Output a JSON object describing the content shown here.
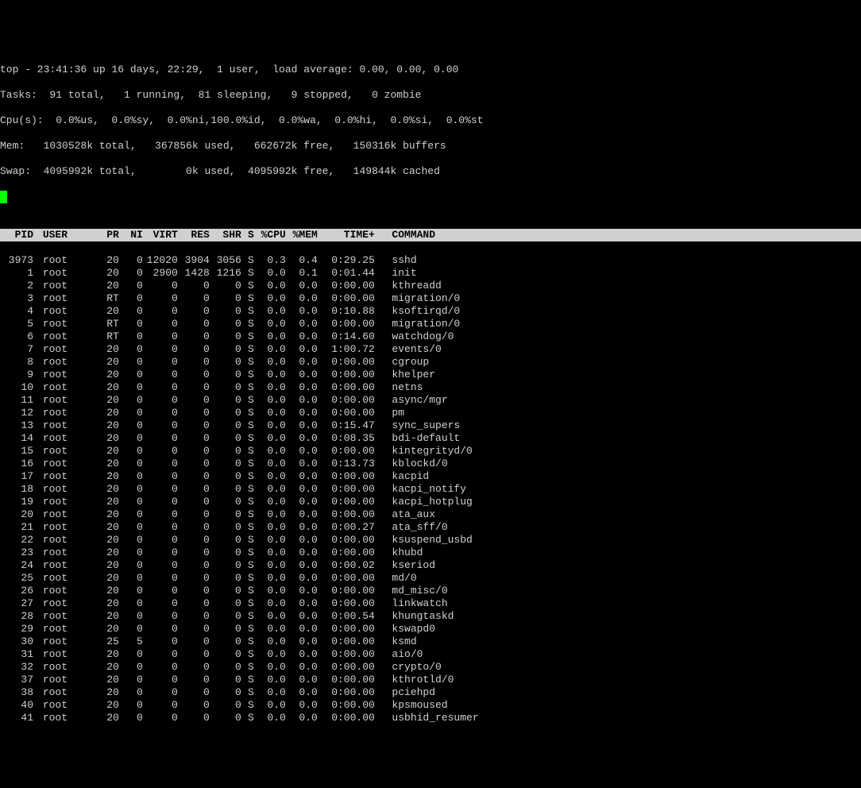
{
  "summary": {
    "line1": "top - 23:41:36 up 16 days, 22:29,  1 user,  load average: 0.00, 0.00, 0.00",
    "line2": "Tasks:  91 total,   1 running,  81 sleeping,   9 stopped,   0 zombie",
    "line3": "Cpu(s):  0.0%us,  0.0%sy,  0.0%ni,100.0%id,  0.0%wa,  0.0%hi,  0.0%si,  0.0%st",
    "line4": "Mem:   1030528k total,   367856k used,   662672k free,   150316k buffers",
    "line5": "Swap:  4095992k total,        0k used,  4095992k free,   149844k cached"
  },
  "columns": {
    "pid": "PID",
    "user": "USER",
    "pr": "PR",
    "ni": "NI",
    "virt": "VIRT",
    "res": "RES",
    "shr": "SHR",
    "s": "S",
    "cpu": "%CPU",
    "mem": "%MEM",
    "time": "TIME+",
    "cmd": "COMMAND"
  },
  "procs": [
    {
      "pid": "3973",
      "user": "root",
      "pr": "20",
      "ni": "0",
      "virt": "12020",
      "res": "3904",
      "shr": "3056",
      "s": "S",
      "cpu": "0.3",
      "mem": "0.4",
      "time": "0:29.25",
      "cmd": "sshd"
    },
    {
      "pid": "1",
      "user": "root",
      "pr": "20",
      "ni": "0",
      "virt": "2900",
      "res": "1428",
      "shr": "1216",
      "s": "S",
      "cpu": "0.0",
      "mem": "0.1",
      "time": "0:01.44",
      "cmd": "init"
    },
    {
      "pid": "2",
      "user": "root",
      "pr": "20",
      "ni": "0",
      "virt": "0",
      "res": "0",
      "shr": "0",
      "s": "S",
      "cpu": "0.0",
      "mem": "0.0",
      "time": "0:00.00",
      "cmd": "kthreadd"
    },
    {
      "pid": "3",
      "user": "root",
      "pr": "RT",
      "ni": "0",
      "virt": "0",
      "res": "0",
      "shr": "0",
      "s": "S",
      "cpu": "0.0",
      "mem": "0.0",
      "time": "0:00.00",
      "cmd": "migration/0"
    },
    {
      "pid": "4",
      "user": "root",
      "pr": "20",
      "ni": "0",
      "virt": "0",
      "res": "0",
      "shr": "0",
      "s": "S",
      "cpu": "0.0",
      "mem": "0.0",
      "time": "0:10.88",
      "cmd": "ksoftirqd/0"
    },
    {
      "pid": "5",
      "user": "root",
      "pr": "RT",
      "ni": "0",
      "virt": "0",
      "res": "0",
      "shr": "0",
      "s": "S",
      "cpu": "0.0",
      "mem": "0.0",
      "time": "0:00.00",
      "cmd": "migration/0"
    },
    {
      "pid": "6",
      "user": "root",
      "pr": "RT",
      "ni": "0",
      "virt": "0",
      "res": "0",
      "shr": "0",
      "s": "S",
      "cpu": "0.0",
      "mem": "0.0",
      "time": "0:14.60",
      "cmd": "watchdog/0"
    },
    {
      "pid": "7",
      "user": "root",
      "pr": "20",
      "ni": "0",
      "virt": "0",
      "res": "0",
      "shr": "0",
      "s": "S",
      "cpu": "0.0",
      "mem": "0.0",
      "time": "1:00.72",
      "cmd": "events/0"
    },
    {
      "pid": "8",
      "user": "root",
      "pr": "20",
      "ni": "0",
      "virt": "0",
      "res": "0",
      "shr": "0",
      "s": "S",
      "cpu": "0.0",
      "mem": "0.0",
      "time": "0:00.00",
      "cmd": "cgroup"
    },
    {
      "pid": "9",
      "user": "root",
      "pr": "20",
      "ni": "0",
      "virt": "0",
      "res": "0",
      "shr": "0",
      "s": "S",
      "cpu": "0.0",
      "mem": "0.0",
      "time": "0:00.00",
      "cmd": "khelper"
    },
    {
      "pid": "10",
      "user": "root",
      "pr": "20",
      "ni": "0",
      "virt": "0",
      "res": "0",
      "shr": "0",
      "s": "S",
      "cpu": "0.0",
      "mem": "0.0",
      "time": "0:00.00",
      "cmd": "netns"
    },
    {
      "pid": "11",
      "user": "root",
      "pr": "20",
      "ni": "0",
      "virt": "0",
      "res": "0",
      "shr": "0",
      "s": "S",
      "cpu": "0.0",
      "mem": "0.0",
      "time": "0:00.00",
      "cmd": "async/mgr"
    },
    {
      "pid": "12",
      "user": "root",
      "pr": "20",
      "ni": "0",
      "virt": "0",
      "res": "0",
      "shr": "0",
      "s": "S",
      "cpu": "0.0",
      "mem": "0.0",
      "time": "0:00.00",
      "cmd": "pm"
    },
    {
      "pid": "13",
      "user": "root",
      "pr": "20",
      "ni": "0",
      "virt": "0",
      "res": "0",
      "shr": "0",
      "s": "S",
      "cpu": "0.0",
      "mem": "0.0",
      "time": "0:15.47",
      "cmd": "sync_supers"
    },
    {
      "pid": "14",
      "user": "root",
      "pr": "20",
      "ni": "0",
      "virt": "0",
      "res": "0",
      "shr": "0",
      "s": "S",
      "cpu": "0.0",
      "mem": "0.0",
      "time": "0:08.35",
      "cmd": "bdi-default"
    },
    {
      "pid": "15",
      "user": "root",
      "pr": "20",
      "ni": "0",
      "virt": "0",
      "res": "0",
      "shr": "0",
      "s": "S",
      "cpu": "0.0",
      "mem": "0.0",
      "time": "0:00.00",
      "cmd": "kintegrityd/0"
    },
    {
      "pid": "16",
      "user": "root",
      "pr": "20",
      "ni": "0",
      "virt": "0",
      "res": "0",
      "shr": "0",
      "s": "S",
      "cpu": "0.0",
      "mem": "0.0",
      "time": "0:13.73",
      "cmd": "kblockd/0"
    },
    {
      "pid": "17",
      "user": "root",
      "pr": "20",
      "ni": "0",
      "virt": "0",
      "res": "0",
      "shr": "0",
      "s": "S",
      "cpu": "0.0",
      "mem": "0.0",
      "time": "0:00.00",
      "cmd": "kacpid"
    },
    {
      "pid": "18",
      "user": "root",
      "pr": "20",
      "ni": "0",
      "virt": "0",
      "res": "0",
      "shr": "0",
      "s": "S",
      "cpu": "0.0",
      "mem": "0.0",
      "time": "0:00.00",
      "cmd": "kacpi_notify"
    },
    {
      "pid": "19",
      "user": "root",
      "pr": "20",
      "ni": "0",
      "virt": "0",
      "res": "0",
      "shr": "0",
      "s": "S",
      "cpu": "0.0",
      "mem": "0.0",
      "time": "0:00.00",
      "cmd": "kacpi_hotplug"
    },
    {
      "pid": "20",
      "user": "root",
      "pr": "20",
      "ni": "0",
      "virt": "0",
      "res": "0",
      "shr": "0",
      "s": "S",
      "cpu": "0.0",
      "mem": "0.0",
      "time": "0:00.00",
      "cmd": "ata_aux"
    },
    {
      "pid": "21",
      "user": "root",
      "pr": "20",
      "ni": "0",
      "virt": "0",
      "res": "0",
      "shr": "0",
      "s": "S",
      "cpu": "0.0",
      "mem": "0.0",
      "time": "0:00.27",
      "cmd": "ata_sff/0"
    },
    {
      "pid": "22",
      "user": "root",
      "pr": "20",
      "ni": "0",
      "virt": "0",
      "res": "0",
      "shr": "0",
      "s": "S",
      "cpu": "0.0",
      "mem": "0.0",
      "time": "0:00.00",
      "cmd": "ksuspend_usbd"
    },
    {
      "pid": "23",
      "user": "root",
      "pr": "20",
      "ni": "0",
      "virt": "0",
      "res": "0",
      "shr": "0",
      "s": "S",
      "cpu": "0.0",
      "mem": "0.0",
      "time": "0:00.00",
      "cmd": "khubd"
    },
    {
      "pid": "24",
      "user": "root",
      "pr": "20",
      "ni": "0",
      "virt": "0",
      "res": "0",
      "shr": "0",
      "s": "S",
      "cpu": "0.0",
      "mem": "0.0",
      "time": "0:00.02",
      "cmd": "kseriod"
    },
    {
      "pid": "25",
      "user": "root",
      "pr": "20",
      "ni": "0",
      "virt": "0",
      "res": "0",
      "shr": "0",
      "s": "S",
      "cpu": "0.0",
      "mem": "0.0",
      "time": "0:00.00",
      "cmd": "md/0"
    },
    {
      "pid": "26",
      "user": "root",
      "pr": "20",
      "ni": "0",
      "virt": "0",
      "res": "0",
      "shr": "0",
      "s": "S",
      "cpu": "0.0",
      "mem": "0.0",
      "time": "0:00.00",
      "cmd": "md_misc/0"
    },
    {
      "pid": "27",
      "user": "root",
      "pr": "20",
      "ni": "0",
      "virt": "0",
      "res": "0",
      "shr": "0",
      "s": "S",
      "cpu": "0.0",
      "mem": "0.0",
      "time": "0:00.00",
      "cmd": "linkwatch"
    },
    {
      "pid": "28",
      "user": "root",
      "pr": "20",
      "ni": "0",
      "virt": "0",
      "res": "0",
      "shr": "0",
      "s": "S",
      "cpu": "0.0",
      "mem": "0.0",
      "time": "0:00.54",
      "cmd": "khungtaskd"
    },
    {
      "pid": "29",
      "user": "root",
      "pr": "20",
      "ni": "0",
      "virt": "0",
      "res": "0",
      "shr": "0",
      "s": "S",
      "cpu": "0.0",
      "mem": "0.0",
      "time": "0:00.00",
      "cmd": "kswapd0"
    },
    {
      "pid": "30",
      "user": "root",
      "pr": "25",
      "ni": "5",
      "virt": "0",
      "res": "0",
      "shr": "0",
      "s": "S",
      "cpu": "0.0",
      "mem": "0.0",
      "time": "0:00.00",
      "cmd": "ksmd"
    },
    {
      "pid": "31",
      "user": "root",
      "pr": "20",
      "ni": "0",
      "virt": "0",
      "res": "0",
      "shr": "0",
      "s": "S",
      "cpu": "0.0",
      "mem": "0.0",
      "time": "0:00.00",
      "cmd": "aio/0"
    },
    {
      "pid": "32",
      "user": "root",
      "pr": "20",
      "ni": "0",
      "virt": "0",
      "res": "0",
      "shr": "0",
      "s": "S",
      "cpu": "0.0",
      "mem": "0.0",
      "time": "0:00.00",
      "cmd": "crypto/0"
    },
    {
      "pid": "37",
      "user": "root",
      "pr": "20",
      "ni": "0",
      "virt": "0",
      "res": "0",
      "shr": "0",
      "s": "S",
      "cpu": "0.0",
      "mem": "0.0",
      "time": "0:00.00",
      "cmd": "kthrotld/0"
    },
    {
      "pid": "38",
      "user": "root",
      "pr": "20",
      "ni": "0",
      "virt": "0",
      "res": "0",
      "shr": "0",
      "s": "S",
      "cpu": "0.0",
      "mem": "0.0",
      "time": "0:00.00",
      "cmd": "pciehpd"
    },
    {
      "pid": "40",
      "user": "root",
      "pr": "20",
      "ni": "0",
      "virt": "0",
      "res": "0",
      "shr": "0",
      "s": "S",
      "cpu": "0.0",
      "mem": "0.0",
      "time": "0:00.00",
      "cmd": "kpsmoused"
    },
    {
      "pid": "41",
      "user": "root",
      "pr": "20",
      "ni": "0",
      "virt": "0",
      "res": "0",
      "shr": "0",
      "s": "S",
      "cpu": "0.0",
      "mem": "0.0",
      "time": "0:00.00",
      "cmd": "usbhid_resumer"
    }
  ]
}
